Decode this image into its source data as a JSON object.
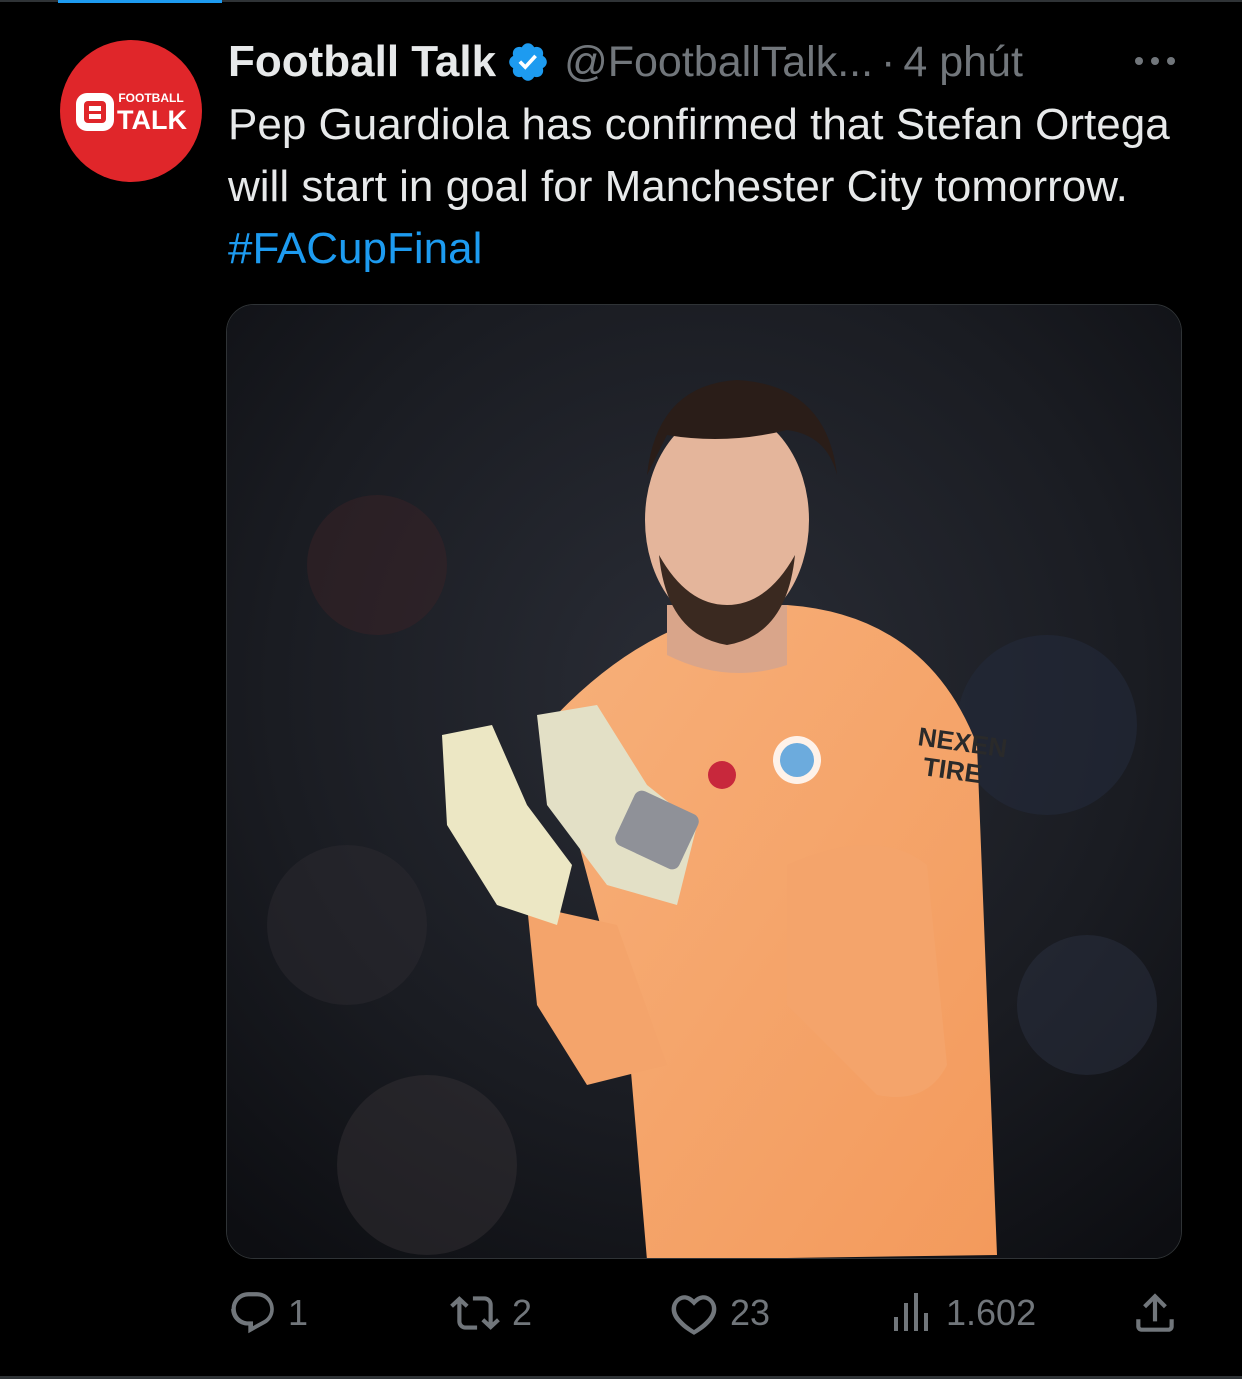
{
  "tweet": {
    "author_name": "Football Talk",
    "handle": "@FootballTalk...",
    "separator": "·",
    "time": "4 phút",
    "text": "Pep Guardiola has confirmed that Stefan Ortega will start in goal for Manchester City tomorrow.",
    "hashtag": "#FACupFinal"
  },
  "avatar": {
    "brand_small": "FOOTBALL",
    "brand_large": "TALK",
    "color": "#e0262a"
  },
  "media": {
    "jersey_sponsor_line1": "NEXEN",
    "jersey_sponsor_line2": "TIRE"
  },
  "actions": {
    "replies": "1",
    "reposts": "2",
    "likes": "23",
    "views": "1.602"
  },
  "colors": {
    "background": "#000000",
    "text": "#e7e9ea",
    "muted": "#71767b",
    "accent": "#1d9bf0"
  },
  "icons": [
    "verified-badge-icon",
    "more-options-icon",
    "reply-icon",
    "repost-icon",
    "like-icon",
    "views-icon",
    "share-icon"
  ]
}
